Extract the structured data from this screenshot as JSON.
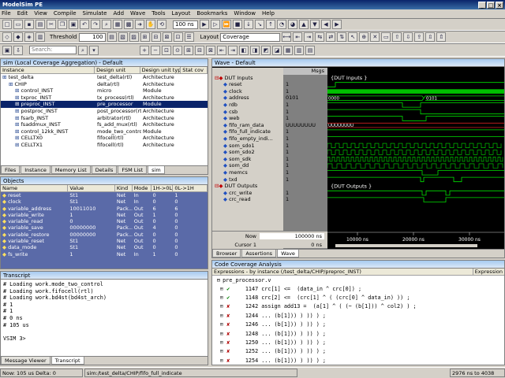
{
  "app": {
    "title": "ModelSim PE"
  },
  "menu": [
    "File",
    "Edit",
    "View",
    "Compile",
    "Simulate",
    "Add",
    "Wave",
    "Tools",
    "Layout",
    "Bookmarks",
    "Window",
    "Help"
  ],
  "toolbar": {
    "threshold_label": "Threshold",
    "threshold_value": "100",
    "run_length": "100 ns",
    "layout_label": "Layout",
    "layout_value": "Coverage",
    "search_placeholder": "Search:"
  },
  "sim_panel": {
    "title": "sim (Local Coverage Aggregation) - Default",
    "columns": [
      "Instance",
      "Design unit",
      "Design unit type",
      "Stat cov"
    ],
    "rows": [
      [
        "test_delta",
        "test_delta(rtl)",
        "Architecture"
      ],
      [
        "CHIP",
        "delta(rtl)",
        "Architecture"
      ],
      [
        "control_INST",
        "micro",
        "Module"
      ],
      [
        "txproc_INST",
        "tx_process(rtl)",
        "Architecture"
      ],
      [
        "preproc_INST",
        "pre_processor",
        "Module"
      ],
      [
        "postproc_INST",
        "post_processor(rtl)",
        "Architecture"
      ],
      [
        "fsarb_INST",
        "arbitrator(rtl)",
        "Architecture"
      ],
      [
        "fsaddmux_INST",
        "fs_add_mux(rtl)",
        "Architecture"
      ],
      [
        "control_12kk_INST",
        "mode_two_control",
        "Module"
      ],
      [
        "CELLTX0",
        "fifocell(rtl)",
        "Architecture"
      ],
      [
        "CELLTX1",
        "fifocell(rtl)",
        "Architecture"
      ]
    ],
    "tabs": [
      "Files",
      "Instance",
      "Memory List",
      "Details",
      "FSM List",
      "sim"
    ]
  },
  "objects": {
    "title": "Objects",
    "columns": [
      "Name",
      "Value",
      "Kind",
      "Mode",
      "1H->0L",
      "0L->1H"
    ],
    "rows": [
      [
        "reset",
        "St1",
        "Net",
        "In",
        "0",
        "1"
      ],
      [
        "clock",
        "St1",
        "Net",
        "In",
        "0",
        "0"
      ],
      [
        "variable_address",
        "10011010",
        "Pack...",
        "Out",
        "6",
        "6"
      ],
      [
        "variable_write",
        "1",
        "Net",
        "Out",
        "1",
        "0"
      ],
      [
        "variable_read",
        "0",
        "Net",
        "Out",
        "0",
        "0"
      ],
      [
        "variable_save",
        "00000000",
        "Pack...",
        "Out",
        "4",
        "0"
      ],
      [
        "variable_restore",
        "00000000",
        "Pack...",
        "Out",
        "0",
        "0"
      ],
      [
        "variable_reset",
        "St1",
        "Net",
        "Out",
        "0",
        "0"
      ],
      [
        "data_mode",
        "St1",
        "Net",
        "Out",
        "0",
        "0"
      ],
      [
        "fs_write",
        "1",
        "Net",
        "In",
        "1",
        "0"
      ]
    ]
  },
  "transcript": {
    "title": "Transcript",
    "lines": [
      "# Loading work.mode_two_control",
      "# Loading work.fifocell(rtl)",
      "# Loading work.bd4st(bd4st_arch)",
      "# 1",
      "# 1",
      "# 0 ns",
      "# 105 us",
      "",
      "VSIM 3>"
    ],
    "tabs": [
      "Message Viewer",
      "Transcript"
    ]
  },
  "wave": {
    "title": "Wave - Default",
    "msgs_label": "Msgs",
    "signals": [
      [
        "DUT Inputs",
        ""
      ],
      [
        "reset",
        "1"
      ],
      [
        "clock",
        "1"
      ],
      [
        "address",
        "0101"
      ],
      [
        "rdb",
        "1"
      ],
      [
        "csb",
        "1"
      ],
      [
        "web",
        "1"
      ],
      [
        "fifo_ram_data",
        "UUUUUUUU"
      ],
      [
        "fifo_full_indicate",
        "1"
      ],
      [
        "fifo_empty_indi...",
        "1"
      ],
      [
        "som_sdo1",
        "1"
      ],
      [
        "som_sdo2",
        "1"
      ],
      [
        "som_sdk",
        "1"
      ],
      [
        "som_dd",
        "1"
      ],
      [
        "memcs",
        "1"
      ],
      [
        "txd",
        "1"
      ],
      [
        "DUT Outputs",
        ""
      ],
      [
        "crc_write",
        "1"
      ],
      [
        "crc_read",
        "1"
      ]
    ],
    "group_labels": [
      "{DUT Inputs }",
      "{DUT Outputs }"
    ],
    "bus_values": [
      "0000",
      "0101",
      "UUUUUUUU"
    ],
    "now_label": "Now",
    "now_value": "100000 ns",
    "cursor_label": "Cursor 1",
    "cursor_value": "0 ns",
    "ticks": [
      "10000 ns",
      "20000 ns",
      "30000 ns"
    ],
    "tabs": [
      "Browser",
      "Assertions",
      "Wave"
    ]
  },
  "coverage": {
    "title": "Code Coverage Analysis",
    "expr_label": "Expressions - by instance (/test_delta/CHIP/preproc_INST)",
    "column": "Expression",
    "file": "pre_processor.v",
    "lines": [
      [
        "1147",
        "crc[1] <=  (data_in ^ crc[0]) ;",
        "ok"
      ],
      [
        "1148",
        "crc[2] <=  (crc[1] ^ ( (crc[0] ^ data_in) )) ;",
        "ok"
      ],
      [
        "1242",
        "assign add13 =  (a[1] ^ ( (~ (b[1])) ^ col2) ) ;",
        "x"
      ],
      [
        "1244",
        "... (b[1])) ) )) ) ;",
        "x"
      ],
      [
        "1246",
        "... (b[1])) ) )) ) ;",
        "x"
      ],
      [
        "1248",
        "... (b[1])) ) )) ) ;",
        "x"
      ],
      [
        "1250",
        "... (b[1])) ) )) ) ;",
        "x"
      ],
      [
        "1252",
        "... (b[1])) ) )) ) ;",
        "x"
      ],
      [
        "1254",
        "... (b[1])) ) )) ) ;",
        "x"
      ]
    ]
  },
  "status": {
    "now": "Now: 105 us  Delta: 0",
    "path": "sim:/test_delta/CHIP/fifo_full_indicate",
    "range": "2976 ns to 4038"
  }
}
